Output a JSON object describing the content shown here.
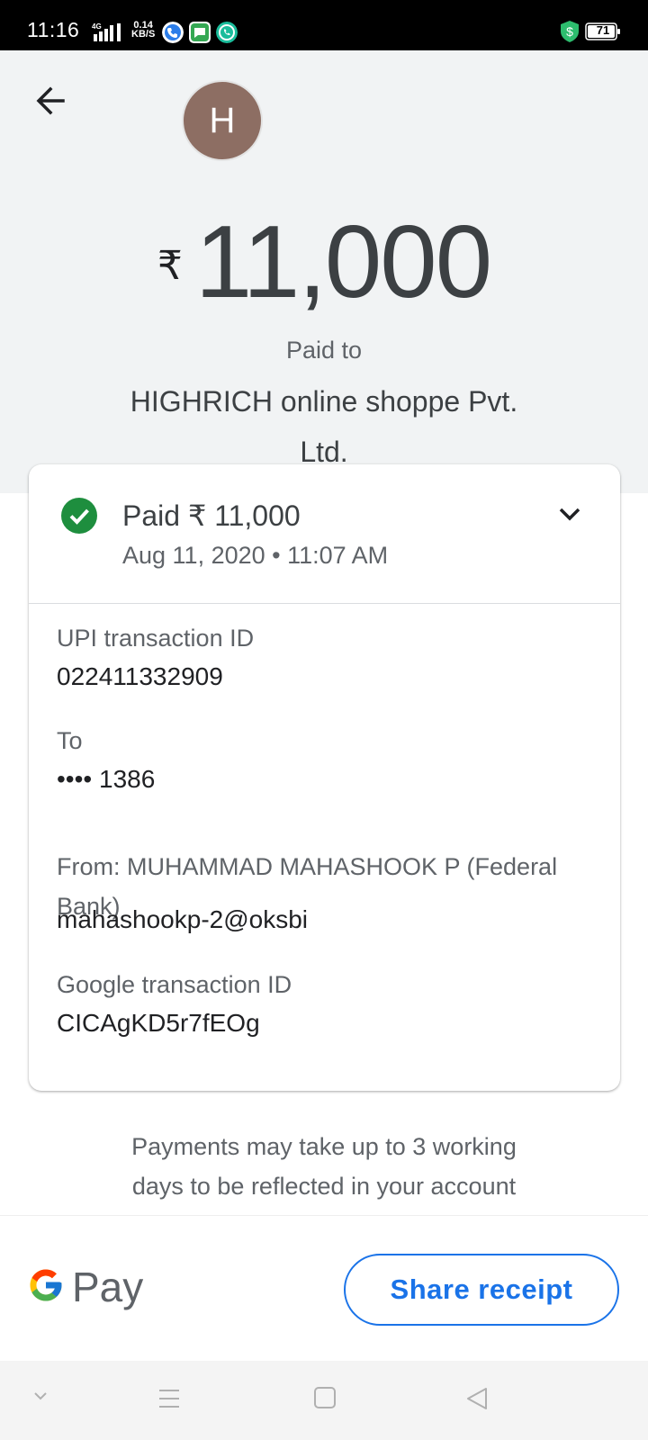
{
  "status_bar": {
    "time": "11:16",
    "network": "4G",
    "speed_value": "0.14",
    "speed_unit": "KB/S",
    "battery": "71"
  },
  "header": {
    "avatar_letter": "H",
    "currency_symbol": "₹",
    "amount": "11,000",
    "paid_to_label": "Paid to",
    "merchant_name": "HIGHRICH online shoppe Pvt. Ltd."
  },
  "summary": {
    "status": "Paid ₹ 11,000",
    "datetime": "Aug 11, 2020 • 11:07 AM"
  },
  "details": {
    "upi_label": "UPI transaction ID",
    "upi_value": "022411332909",
    "to_label": "To",
    "to_value": "•••• 1386",
    "from_label": "From: MUHAMMAD MAHASHOOK P (Federal Bank)",
    "from_value": "mahashookp-2@oksbi",
    "google_label": "Google transaction ID",
    "google_value": "CICAgKD5r7fEOg"
  },
  "notice": "Payments may take up to 3 working days to be reflected in your account",
  "footer": {
    "brand": "Pay",
    "share_label": "Share receipt"
  },
  "colors": {
    "accent": "#1a73e8",
    "success": "#1e8e3e",
    "avatar": "#8d6e63"
  }
}
